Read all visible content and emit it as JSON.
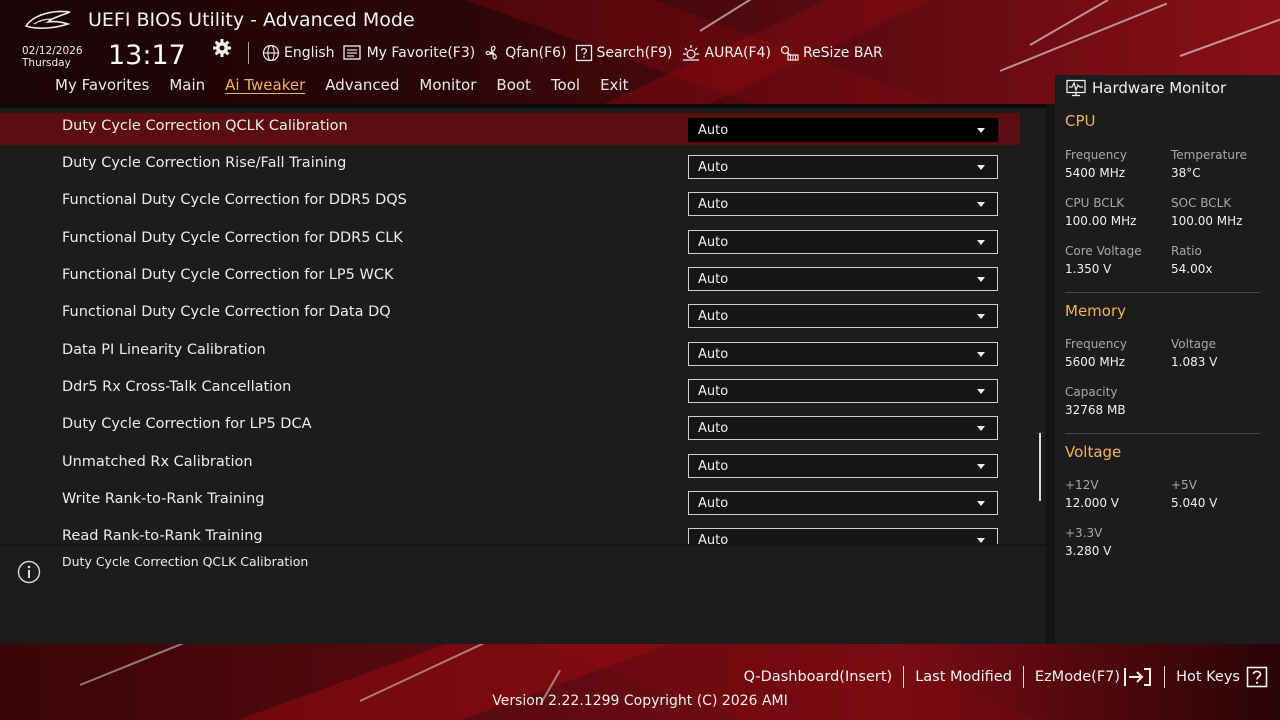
{
  "header": {
    "app_title": "UEFI BIOS Utility - Advanced Mode",
    "date": "02/12/2026",
    "weekday": "Thursday",
    "time": "13:17",
    "toolbar": [
      {
        "icon": "globe-icon",
        "label": "English"
      },
      {
        "icon": "favorite-icon",
        "label": "My Favorite(F3)"
      },
      {
        "icon": "fan-icon",
        "label": "Qfan(F6)"
      },
      {
        "icon": "search-help-icon",
        "label": "Search(F9)"
      },
      {
        "icon": "aura-icon",
        "label": "AURA(F4)"
      },
      {
        "icon": "resize-bar-icon",
        "label": "ReSize BAR"
      }
    ]
  },
  "nav": {
    "tabs": [
      "My Favorites",
      "Main",
      "Ai Tweaker",
      "Advanced",
      "Monitor",
      "Boot",
      "Tool",
      "Exit"
    ],
    "active": "Ai Tweaker"
  },
  "settings": [
    {
      "label": "Duty Cycle Correction QCLK Calibration",
      "value": "Auto",
      "selected": true
    },
    {
      "label": "Duty Cycle Correction Rise/Fall Training",
      "value": "Auto"
    },
    {
      "label": "Functional Duty Cycle Correction for DDR5 DQS",
      "value": "Auto"
    },
    {
      "label": "Functional Duty Cycle Correction for DDR5 CLK",
      "value": "Auto"
    },
    {
      "label": "Functional Duty Cycle Correction for LP5 WCK",
      "value": "Auto"
    },
    {
      "label": "Functional Duty Cycle Correction for Data DQ",
      "value": "Auto"
    },
    {
      "label": "Data PI Linearity Calibration",
      "value": "Auto"
    },
    {
      "label": "Ddr5 Rx Cross-Talk Cancellation",
      "value": "Auto"
    },
    {
      "label": "Duty Cycle Correction for LP5 DCA",
      "value": "Auto"
    },
    {
      "label": "Unmatched Rx Calibration",
      "value": "Auto"
    },
    {
      "label": "Write Rank-to-Rank Training",
      "value": "Auto"
    },
    {
      "label": "Read Rank-to-Rank Training",
      "value": "Auto"
    }
  ],
  "help": {
    "text": "Duty Cycle Correction QCLK Calibration"
  },
  "hardware_monitor": {
    "title": "Hardware Monitor",
    "cpu": {
      "heading": "CPU",
      "frequency_label": "Frequency",
      "frequency": "5400 MHz",
      "temperature_label": "Temperature",
      "temperature": "38°C",
      "cpu_bclk_label": "CPU BCLK",
      "cpu_bclk": "100.00 MHz",
      "soc_bclk_label": "SOC BCLK",
      "soc_bclk": "100.00 MHz",
      "core_voltage_label": "Core Voltage",
      "core_voltage": "1.350 V",
      "ratio_label": "Ratio",
      "ratio": "54.00x"
    },
    "memory": {
      "heading": "Memory",
      "frequency_label": "Frequency",
      "frequency": "5600 MHz",
      "voltage_label": "Voltage",
      "voltage": "1.083 V",
      "capacity_label": "Capacity",
      "capacity": "32768 MB"
    },
    "voltage": {
      "heading": "Voltage",
      "v12_label": "+12V",
      "v12": "12.000 V",
      "v5_label": "+5V",
      "v5": "5.040 V",
      "v33_label": "+3.3V",
      "v33": "3.280 V"
    }
  },
  "footer": {
    "q_dashboard": "Q-Dashboard(Insert)",
    "last_modified": "Last Modified",
    "ez_mode": "EzMode(F7)",
    "hot_keys": "Hot Keys",
    "version": "Version 2.22.1299 Copyright (C) 2026 AMI"
  },
  "colors": {
    "accent": "#f0b25a",
    "selected_row": "#5c0d12",
    "panel": "#1c1c1c"
  }
}
